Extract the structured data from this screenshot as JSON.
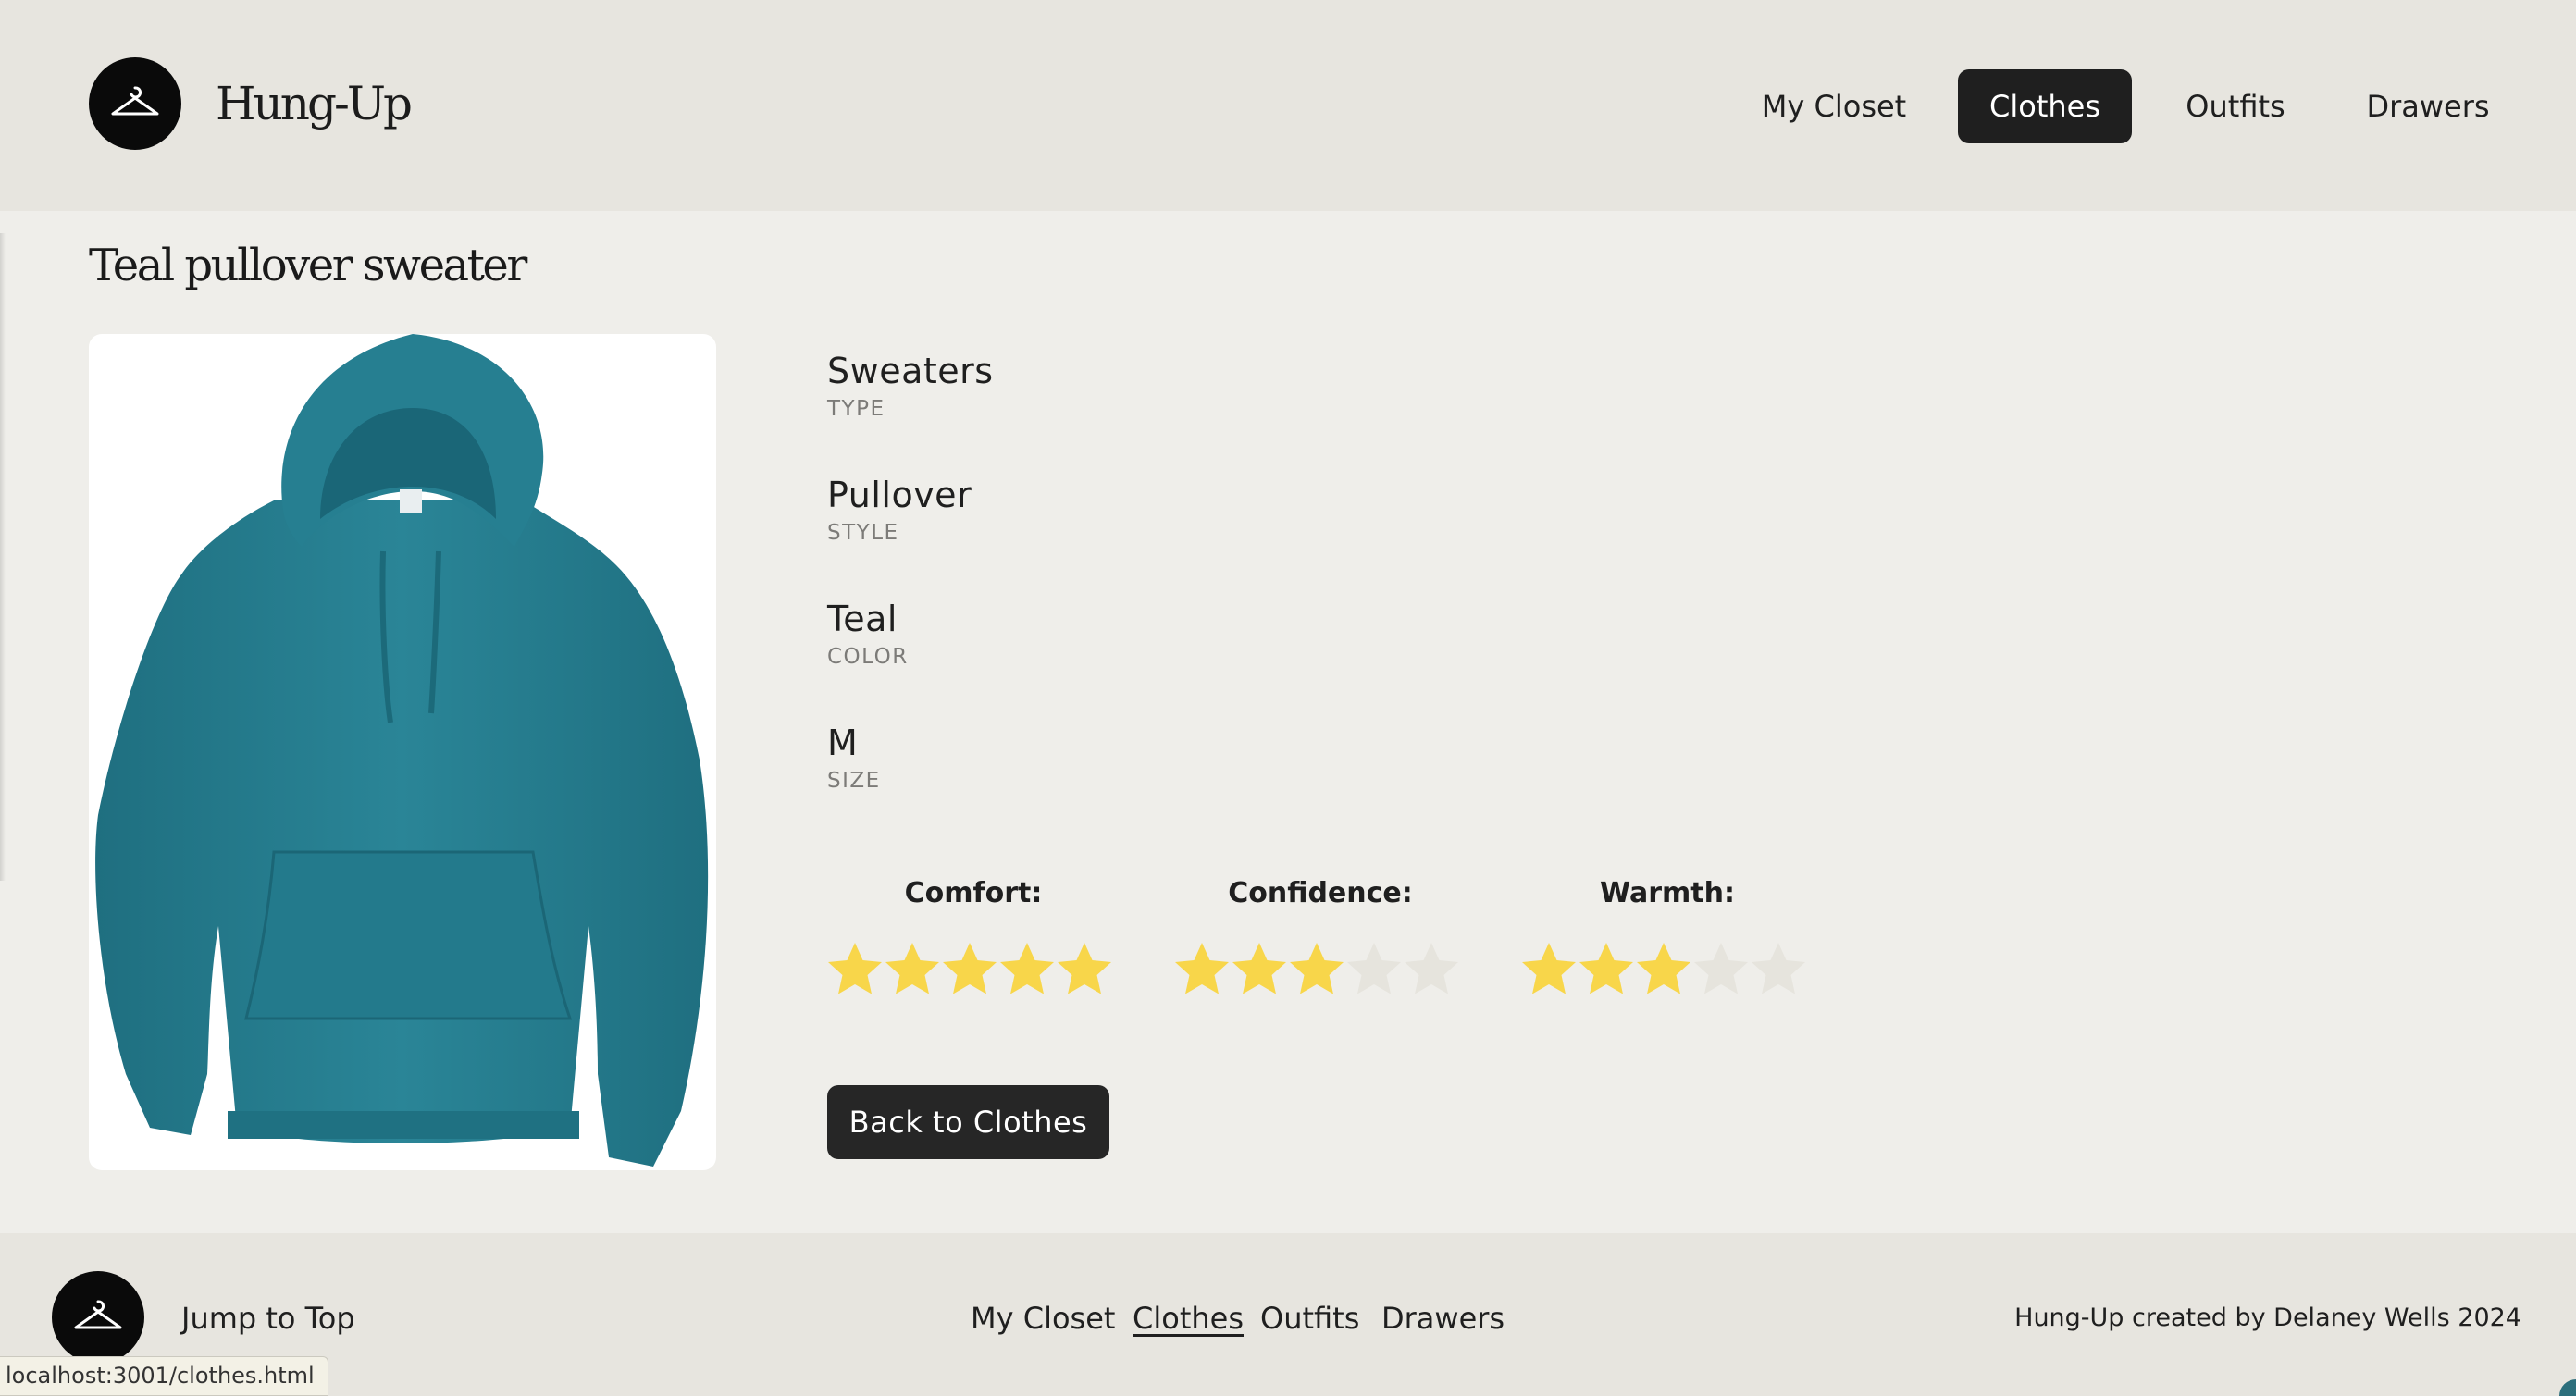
{
  "header": {
    "brand": "Hung-Up",
    "nav": [
      {
        "label": "My Closet",
        "active": false
      },
      {
        "label": "Clothes",
        "active": true
      },
      {
        "label": "Outfits",
        "active": false
      },
      {
        "label": "Drawers",
        "active": false
      }
    ]
  },
  "item": {
    "title": "Teal pullover sweater",
    "image": "teal-hoodie-photo",
    "image_color": "#267f91",
    "attributes": [
      {
        "value": "Sweaters",
        "label": "TYPE"
      },
      {
        "value": "Pullover",
        "label": "STYLE"
      },
      {
        "value": "Teal",
        "label": "COLOR"
      },
      {
        "value": "M",
        "label": "SIZE"
      }
    ],
    "ratings": [
      {
        "label": "Comfort:",
        "stars": 5,
        "max": 5
      },
      {
        "label": "Confidence:",
        "stars": 3,
        "max": 5
      },
      {
        "label": "Warmth:",
        "stars": 3,
        "max": 5
      }
    ],
    "back_button": "Back to Clothes"
  },
  "colors": {
    "star_filled": "#f8d64a",
    "star_empty": "#e6e4dd",
    "accent_dark": "#1f1f1f"
  },
  "footer": {
    "jump_to_top": "Jump to Top",
    "links": [
      {
        "label": "My Closet",
        "active": false
      },
      {
        "label": "Clothes",
        "active": true
      },
      {
        "label": "Outfits",
        "active": false
      },
      {
        "label": "Drawers",
        "active": false
      }
    ],
    "credit": "Hung-Up created by Delaney Wells 2024"
  },
  "status_bar": {
    "url": "localhost:3001/clothes.html"
  }
}
